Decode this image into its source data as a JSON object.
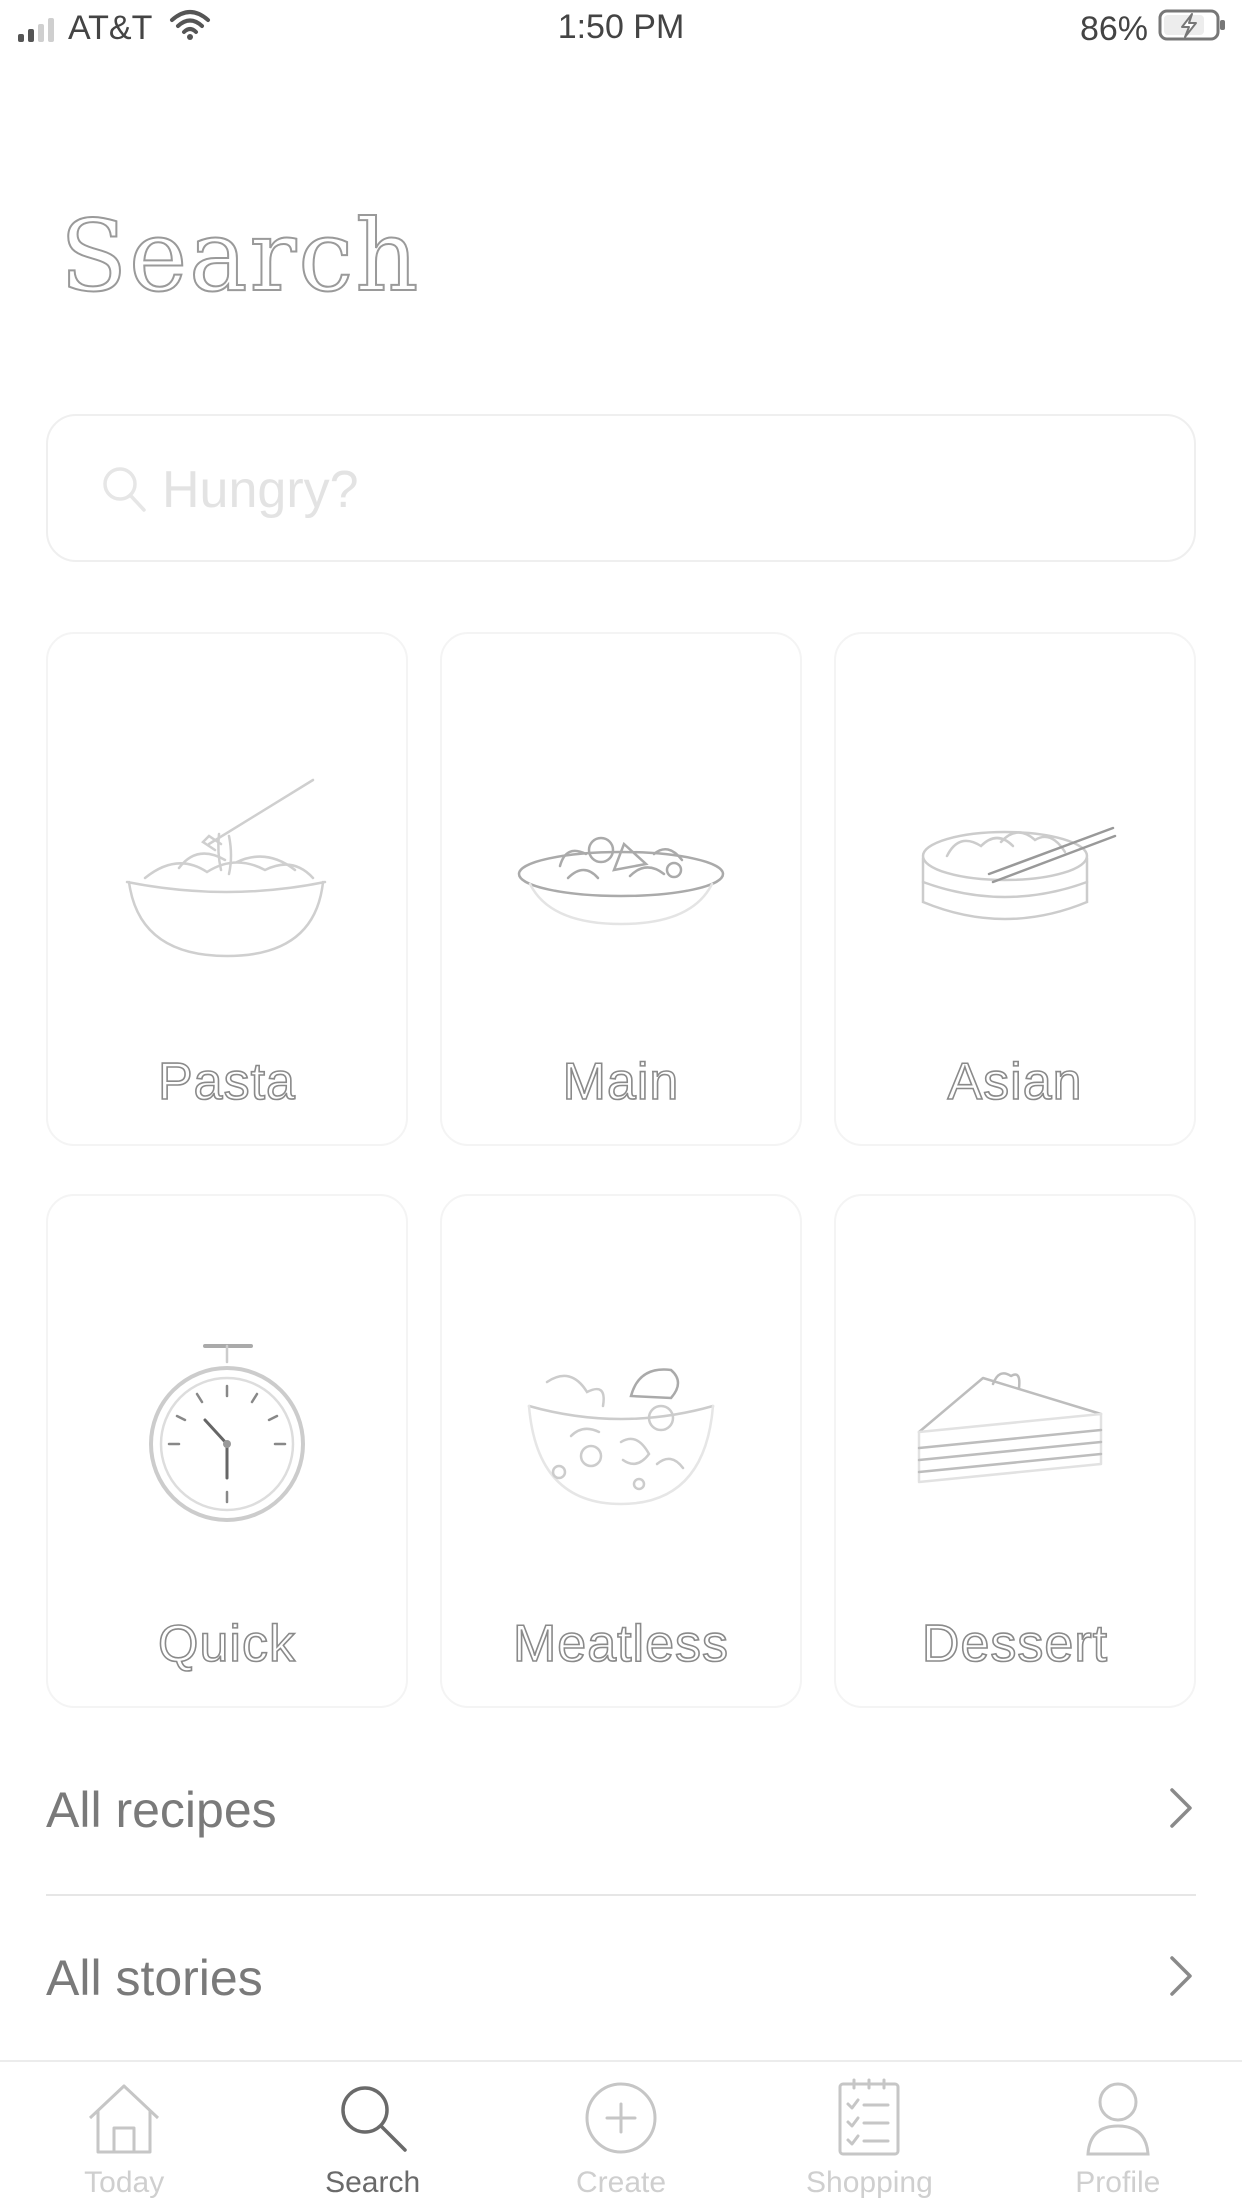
{
  "status_bar": {
    "carrier": "AT&T",
    "time": "1:50 PM",
    "battery": "86%"
  },
  "page": {
    "title": "Search"
  },
  "search": {
    "placeholder": "Hungry?"
  },
  "categories": [
    {
      "label": "Pasta",
      "icon": "pasta-bowl-icon"
    },
    {
      "label": "Main",
      "icon": "main-dish-icon"
    },
    {
      "label": "Asian",
      "icon": "dumpling-bowl-icon"
    },
    {
      "label": "Quick",
      "icon": "stopwatch-icon"
    },
    {
      "label": "Meatless",
      "icon": "salad-bowl-icon"
    },
    {
      "label": "Dessert",
      "icon": "cake-slice-icon"
    }
  ],
  "links": {
    "all_recipes": "All recipes",
    "all_stories": "All stories"
  },
  "tab_bar": {
    "active": "Search",
    "tabs": [
      {
        "label": "Today",
        "icon": "home-icon"
      },
      {
        "label": "Search",
        "icon": "search-icon"
      },
      {
        "label": "Create",
        "icon": "plus-circle-icon"
      },
      {
        "label": "Shopping",
        "icon": "checklist-icon"
      },
      {
        "label": "Profile",
        "icon": "person-icon"
      }
    ]
  },
  "colors": {
    "background": "#ffffff",
    "text": "#6e6e6e",
    "border": "#efefef",
    "inactive_tab": "#cfcfcf"
  }
}
